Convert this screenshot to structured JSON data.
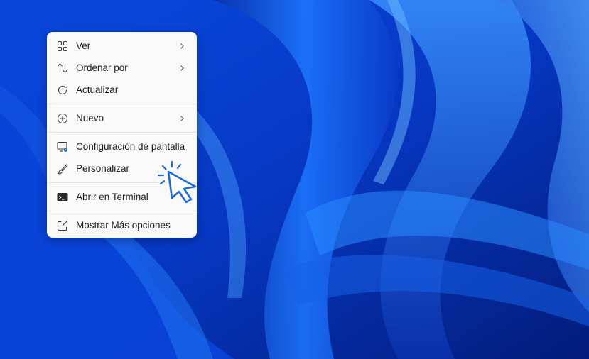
{
  "context_menu": {
    "items": [
      {
        "label": "Ver",
        "icon": "grid-icon",
        "submenu": true
      },
      {
        "label": "Ordenar por",
        "icon": "sort-icon",
        "submenu": true
      },
      {
        "label": "Actualizar",
        "icon": "refresh-icon",
        "submenu": false
      },
      {
        "label": "Nuevo",
        "icon": "new-icon",
        "submenu": true
      },
      {
        "label": "Configuración de pantalla",
        "icon": "display-settings-icon",
        "submenu": false
      },
      {
        "label": "Personalizar",
        "icon": "brush-icon",
        "submenu": false
      },
      {
        "label": "Abrir en Terminal",
        "icon": "terminal-icon",
        "submenu": false
      },
      {
        "label": "Mostrar Más opciones",
        "icon": "more-options-icon",
        "submenu": false
      }
    ]
  },
  "colors": {
    "wallpaper_base": "#0b3fd0",
    "menu_bg": "#f9f9f9",
    "accent": "#1d6bd6"
  }
}
